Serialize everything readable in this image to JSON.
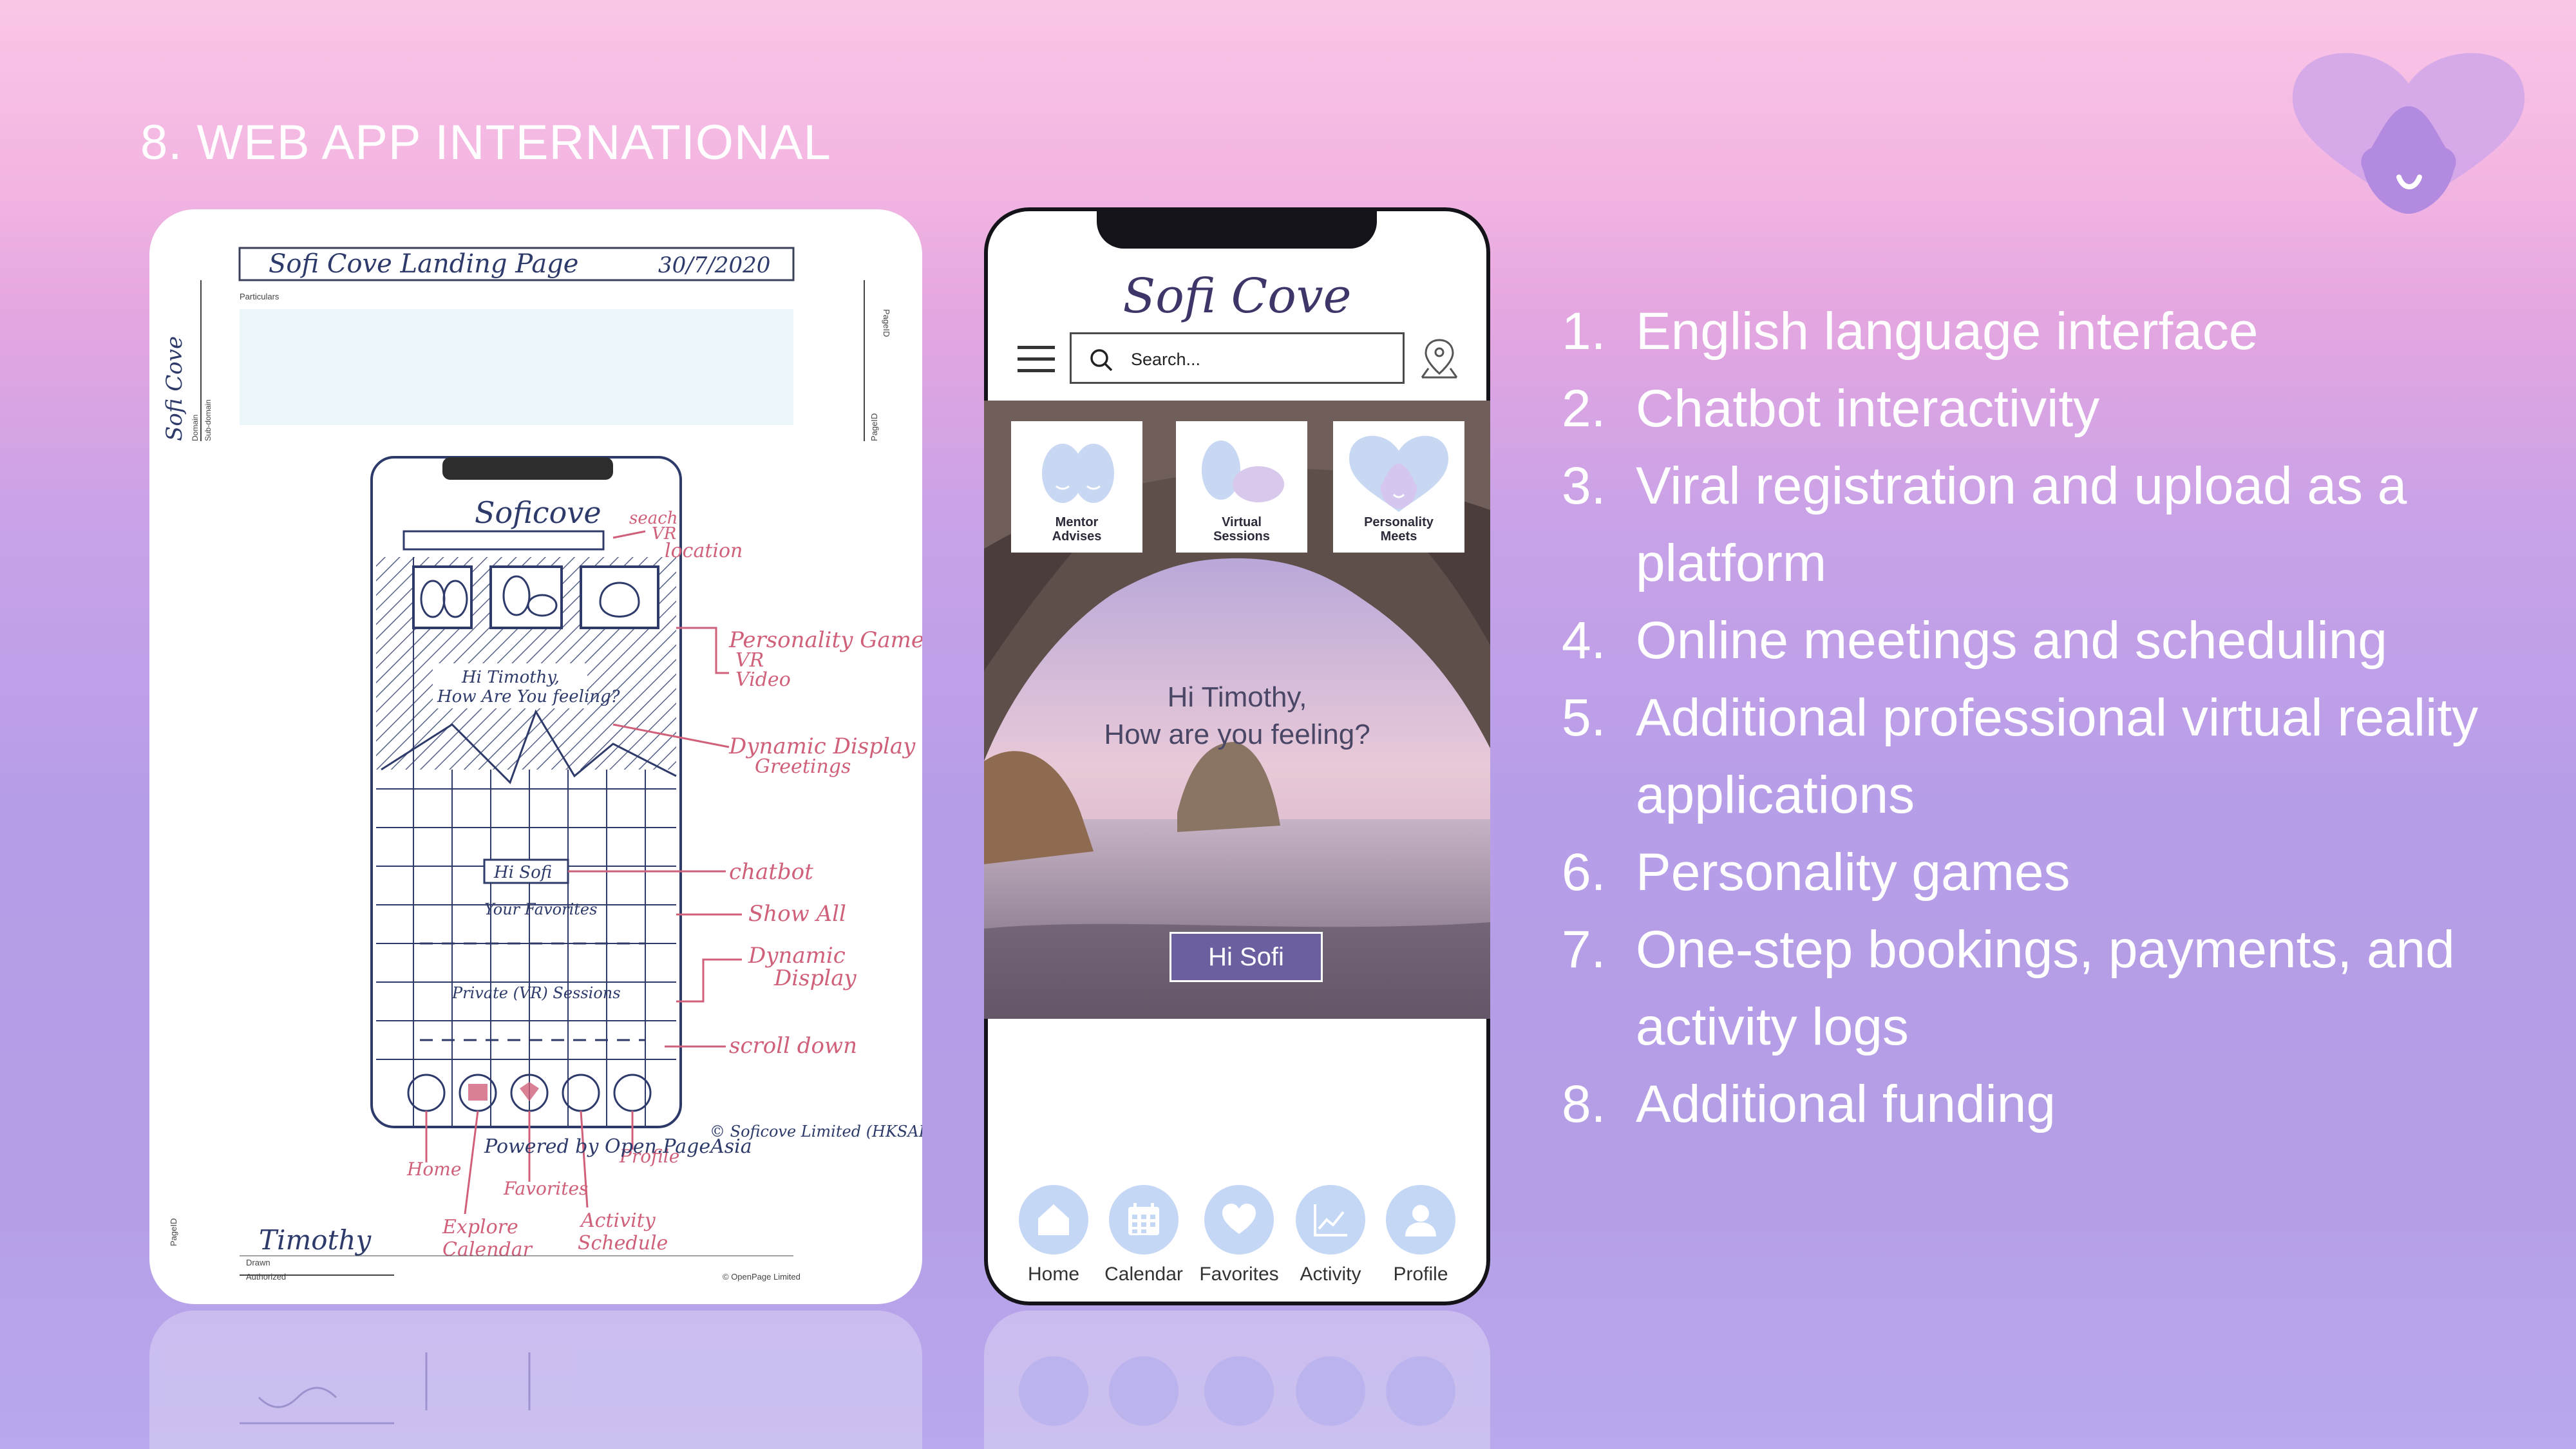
{
  "slide": {
    "title": "8. WEB APP INTERNATIONAL"
  },
  "sketch": {
    "title": "Sofi Cove Landing Page",
    "date": "30/7/2020",
    "app_name": "Soficove",
    "greeting": "Hi Timothy, How Are You feeling?",
    "chat_button": "Hi Sofi",
    "favorites_row": "Your Favorites",
    "sessions_row": "Private (VR) Sessions",
    "annotations": [
      "search",
      "VR",
      "location",
      "Personality Game",
      "VR",
      "Video",
      "Dynamic Display",
      "Greetings",
      "chatbot",
      "Show All",
      "Dynamic Display",
      "scroll down",
      "Home",
      "Favorites",
      "Profile",
      "Explore",
      "Calendar",
      "Activity",
      "Schedule"
    ],
    "footer": "Powered by Open.PageAsia",
    "copyright": "© Soficove Limited (HKSAR)",
    "signature": "Timothy",
    "drawn_label": "Drawn",
    "authorized_label": "Authorized",
    "openpage": "© OpenPage Limited",
    "particulars": "Particulars",
    "domain": "Domain",
    "subdomain": "Sub-domain",
    "page_id": "PageID"
  },
  "phone": {
    "brand": "Sofi Cove",
    "search_placeholder": "Search...",
    "tiles": [
      {
        "label_line1": "Mentor",
        "label_line2": "Advises"
      },
      {
        "label_line1": "Virtual",
        "label_line2": "Sessions"
      },
      {
        "label_line1": "Personality",
        "label_line2": "Meets"
      }
    ],
    "greeting_line1": "Hi Timothy,",
    "greeting_line2": "How are you feeling?",
    "chat_button": "Hi Sofi",
    "nav": [
      {
        "label": "Home",
        "icon": "home-icon"
      },
      {
        "label": "Calendar",
        "icon": "calendar-icon"
      },
      {
        "label": "Favorites",
        "icon": "heart-icon"
      },
      {
        "label": "Activity",
        "icon": "chart-icon"
      },
      {
        "label": "Profile",
        "icon": "user-icon"
      }
    ]
  },
  "features": [
    {
      "num": "1.",
      "text": "English language interface"
    },
    {
      "num": "2.",
      "text": "Chatbot interactivity"
    },
    {
      "num": "3.",
      "text": "Viral registration and upload as a platform"
    },
    {
      "num": "4.",
      "text": "Online meetings and scheduling"
    },
    {
      "num": "5.",
      "text": "Additional professional virtual reality applications"
    },
    {
      "num": "6.",
      "text": "Personality games"
    },
    {
      "num": "7.",
      "text": "One-step bookings, payments, and activity logs"
    },
    {
      "num": "8.",
      "text": "Additional funding"
    }
  ],
  "colors": {
    "accent": "#6b5fa0",
    "brand_text": "#3e3669",
    "nav_circle": "#c4d7f5",
    "sketch_ink": "#2d3a6a",
    "sketch_red": "#d0607a"
  }
}
